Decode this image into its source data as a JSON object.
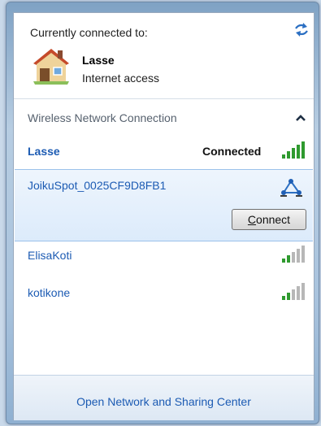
{
  "header": {
    "currently_connected_label": "Currently connected to:",
    "network_name": "Lasse",
    "network_access": "Internet access"
  },
  "section": {
    "title": "Wireless Network Connection"
  },
  "networks": [
    {
      "name": "Lasse",
      "status": "Connected",
      "signal_color": "#2f9a2f"
    },
    {
      "name": "JoikuSpot_0025CF9D8FB1",
      "action": "Connect",
      "action_accesskey": "C"
    },
    {
      "name": "ElisaKoti",
      "signal_color": "#2f9a2f"
    },
    {
      "name": "kotikone",
      "signal_color": "#2f9a2f"
    }
  ],
  "footer": {
    "link": "Open Network and Sharing Center"
  },
  "colors": {
    "link_blue": "#1c5bb3",
    "selection_bg": "#dcebfb",
    "signal_green": "#2f9a2f"
  }
}
